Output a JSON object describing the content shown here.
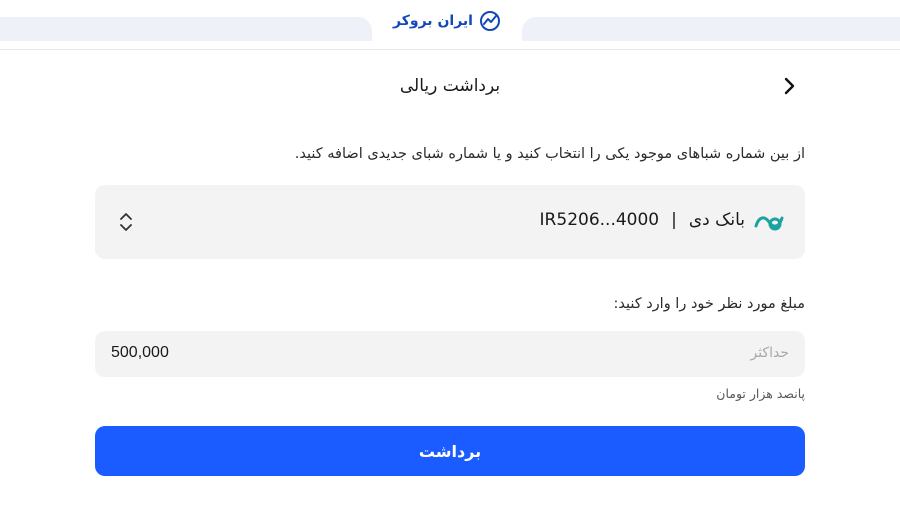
{
  "brand": {
    "name": "ایران بروکر",
    "color": "#1448b8"
  },
  "header": {
    "title": "برداشت ریالی",
    "back_icon": "chevron-right-icon"
  },
  "instruction": "از بین شماره شباهای موجود یکی را انتخاب کنید و یا شماره شبای جدیدی اضافه کنید.",
  "account_selector": {
    "bank_name": "بانک دی",
    "separator": "|",
    "account_masked": "IR5206...4000",
    "bank_logo_icon": "bank-dey-logo-icon",
    "chevron_icon": "chevron-up-down-icon"
  },
  "amount": {
    "label": "مبلغ مورد نظر خود را وارد کنید:",
    "placeholder": "حداکثر",
    "value": "500,000",
    "in_words": "پانصد هزار تومان"
  },
  "submit": {
    "label": "برداشت",
    "color": "#1a5cff"
  }
}
